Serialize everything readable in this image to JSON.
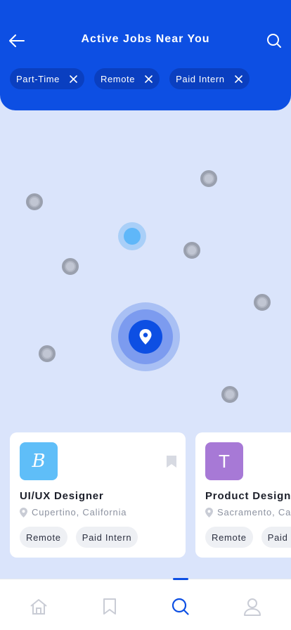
{
  "header": {
    "title": "Active Jobs Near You",
    "filters": [
      {
        "label": "Part-Time"
      },
      {
        "label": "Remote"
      },
      {
        "label": "Paid Intern"
      }
    ]
  },
  "cards": [
    {
      "logo_letter": "B",
      "logo_color": "#5fbef8",
      "role": "UI/UX Designer",
      "location": "Cupertino, California",
      "tags": [
        "Remote",
        "Paid Intern"
      ]
    },
    {
      "logo_letter": "T",
      "logo_color": "#a779d6",
      "role": "Product Designer",
      "location": "Sacramento, California",
      "tags": [
        "Remote",
        "Paid Intern"
      ]
    }
  ],
  "nav": {
    "items": [
      "home-icon",
      "bookmark-icon",
      "search-icon",
      "profile-icon"
    ],
    "active": "search-icon"
  },
  "colors": {
    "primary": "#0d4fe3",
    "background": "#dae4fb"
  }
}
